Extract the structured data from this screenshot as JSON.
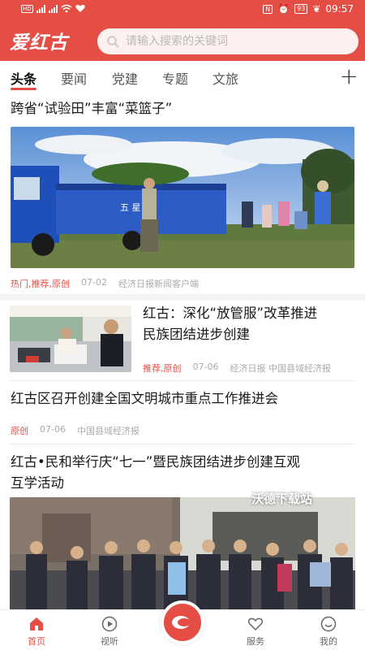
{
  "status_bar": {
    "time": "09:57",
    "battery": "93"
  },
  "header": {
    "logo": "爱红古",
    "search_placeholder": "请输入搜索的关键词"
  },
  "tabs": [
    "头条",
    "要闻",
    "党建",
    "专题",
    "文旅"
  ],
  "articles": [
    {
      "title": "跨省“试验田”丰富“菜篮子”",
      "tags": "热门,推荐,原创",
      "date": "07-02",
      "source": "经济日报新闻客户端"
    },
    {
      "title_line1": "红古：深化“放管服”改革推进",
      "title_line2": "民族团结进步创建",
      "tags": "推荐,原创",
      "date": "07-06",
      "source": "经济日报 中国县域经济报"
    },
    {
      "title": "红古区召开创建全国文明城市重点工作推进会",
      "tags": "原创",
      "date": "07-06",
      "source": "中国县域经济报"
    },
    {
      "title_line1": "红古•民和举行庆“七一”暨民族团结进步创建互观",
      "title_line2": "互学活动"
    }
  ],
  "watermark": "沃德下载站",
  "nav": {
    "home": "首页",
    "video": "视听",
    "service": "服务",
    "mine": "我的"
  },
  "colors": {
    "brand": "#e54e45"
  }
}
